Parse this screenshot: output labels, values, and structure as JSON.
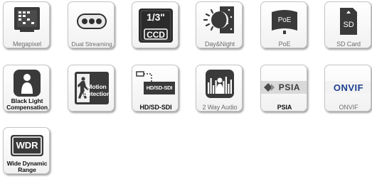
{
  "features": {
    "megapixel": {
      "label": "Megapixel"
    },
    "dual_streaming": {
      "label": "Dual Streaming"
    },
    "ccd": {
      "label": "CCD",
      "size": "1/3\""
    },
    "day_night": {
      "label": "Day&Night"
    },
    "poe": {
      "label": "PoE",
      "badge": "PoE"
    },
    "sd_card": {
      "label": "SD Card",
      "badge": "SD"
    },
    "blc": {
      "label_line1": "Black Light",
      "label_line2": "Compensation"
    },
    "motion_detection": {
      "badge_line1": "Motion",
      "badge_line2": "Detection"
    },
    "hd_sdi": {
      "label": "HD/SD-SDI",
      "badge": "HD/SD-SDI"
    },
    "two_way_audio": {
      "label": "2 Way Audio"
    },
    "psia": {
      "label": "PSIA",
      "logo": "PSIA"
    },
    "onvif": {
      "label": "ONVIF",
      "logo": "ONVIF"
    },
    "wdr": {
      "badge": "WDR",
      "label_line1": "Wide Dynamic",
      "label_line2": "Range"
    }
  },
  "colors": {
    "icon_dark": "#3a3a3a",
    "label_gray": "#6e6e6e",
    "label_black": "#111111",
    "tile_border": "#c4c4c4",
    "onvif_blue": "#1d3f8f"
  }
}
